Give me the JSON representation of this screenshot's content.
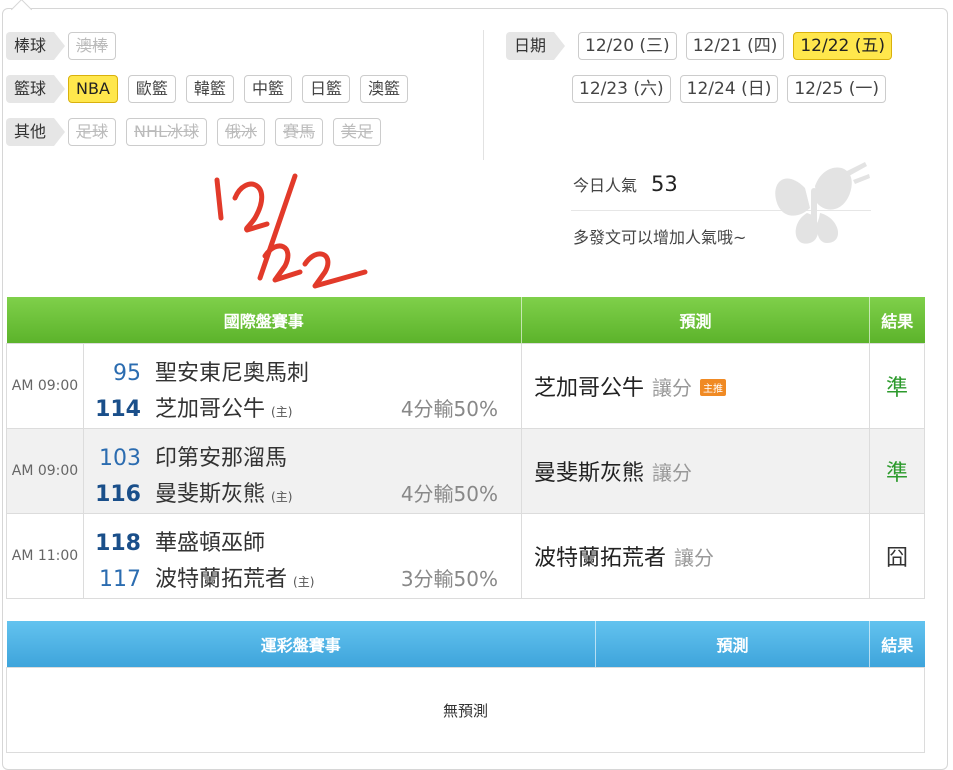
{
  "filters": {
    "baseball": {
      "label": "棒球",
      "items": [
        {
          "label": "澳棒",
          "state": "disabled"
        }
      ]
    },
    "basketball": {
      "label": "籃球",
      "items": [
        {
          "label": "NBA",
          "state": "selected"
        },
        {
          "label": "歐籃",
          "state": "normal"
        },
        {
          "label": "韓籃",
          "state": "normal"
        },
        {
          "label": "中籃",
          "state": "normal"
        },
        {
          "label": "日籃",
          "state": "normal"
        },
        {
          "label": "澳籃",
          "state": "normal"
        }
      ]
    },
    "other": {
      "label": "其他",
      "items": [
        {
          "label": "足球",
          "state": "disabled"
        },
        {
          "label": "NHL冰球",
          "state": "disabled"
        },
        {
          "label": "俄冰",
          "state": "disabled"
        },
        {
          "label": "賽馬",
          "state": "disabled"
        },
        {
          "label": "美足",
          "state": "disabled"
        }
      ]
    }
  },
  "dates": {
    "label": "日期",
    "items": [
      {
        "label": "12/20 (三)",
        "selected": false
      },
      {
        "label": "12/21 (四)",
        "selected": false
      },
      {
        "label": "12/22 (五)",
        "selected": true
      },
      {
        "label": "12/23 (六)",
        "selected": false
      },
      {
        "label": "12/24 (日)",
        "selected": false
      },
      {
        "label": "12/25 (一)",
        "selected": false
      }
    ]
  },
  "popularity": {
    "label": "今日人氣",
    "value": "53",
    "tip": "多發文可以增加人氣哦~"
  },
  "colors": {
    "green_header": "#5cb32b",
    "blue_header": "#3ea4db",
    "selected_chip": "#ffe74c",
    "correct": "#2c9a2c"
  },
  "intl_table": {
    "headers": {
      "event": "國際盤賽事",
      "prediction": "預測",
      "result": "結果"
    },
    "rows": [
      {
        "time": "AM 09:00",
        "away": {
          "score": "95",
          "team": "聖安東尼奧馬刺"
        },
        "home": {
          "score": "114",
          "team": "芝加哥公牛",
          "host": "(主)"
        },
        "spread": "4分輸50%",
        "pick": "芝加哥公牛",
        "pick_type": "讓分",
        "badge": "主推",
        "result": "準"
      },
      {
        "time": "AM 09:00",
        "away": {
          "score": "103",
          "team": "印第安那溜馬"
        },
        "home": {
          "score": "116",
          "team": "曼斐斯灰熊",
          "host": "(主)"
        },
        "spread": "4分輸50%",
        "pick": "曼斐斯灰熊",
        "pick_type": "讓分",
        "badge": "",
        "result": "準"
      },
      {
        "time": "AM 11:00",
        "away": {
          "score": "118",
          "team": "華盛頓巫師"
        },
        "home": {
          "score": "117",
          "team": "波特蘭拓荒者",
          "host": "(主)"
        },
        "spread": "3分輸50%",
        "pick": "波特蘭拓荒者",
        "pick_type": "讓分",
        "badge": "",
        "result": "囧"
      }
    ]
  },
  "sport_table": {
    "headers": {
      "event": "運彩盤賽事",
      "prediction": "預測",
      "result": "結果"
    },
    "empty": "無預測"
  },
  "handwriting": {
    "text": "12/22"
  }
}
